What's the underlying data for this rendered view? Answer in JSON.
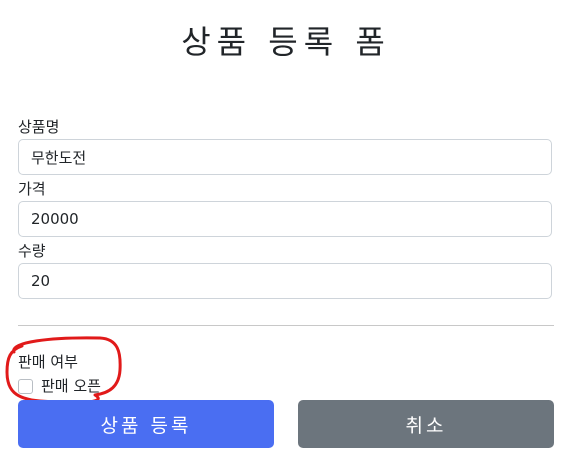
{
  "form": {
    "title": "상품 등록 폼",
    "fields": [
      {
        "label": "상품명",
        "value": "무한도전"
      },
      {
        "label": "가격",
        "value": "20000"
      },
      {
        "label": "수량",
        "value": "20"
      }
    ],
    "sale_section": {
      "title": "판매 여부",
      "checkbox_label": "판매 오픈",
      "checked": false
    },
    "buttons": {
      "submit_label": "상품 등록",
      "cancel_label": "취소"
    }
  },
  "colors": {
    "primary": "#4a6ef2",
    "secondary": "#6c757d",
    "annotation": "#e11a1a"
  }
}
